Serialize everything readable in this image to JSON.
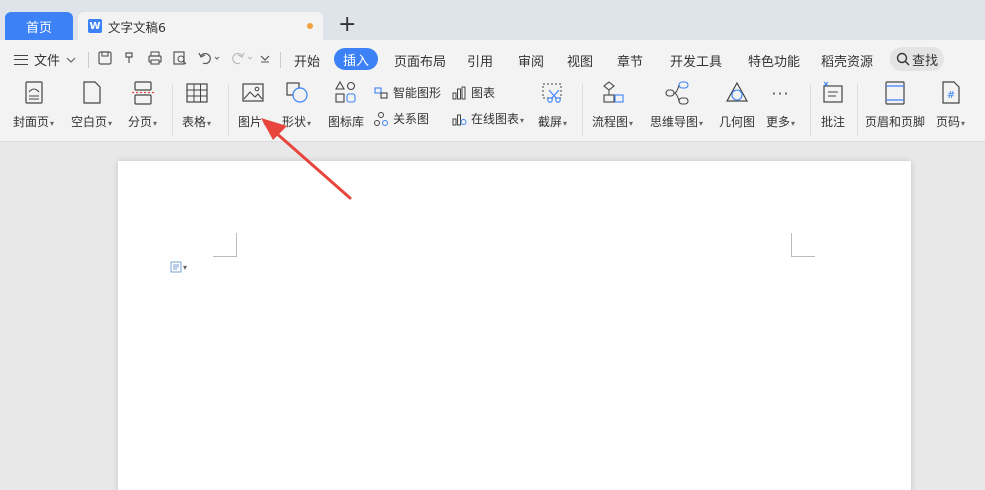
{
  "tabs": {
    "home": "首页",
    "doc_icon": "W",
    "document": "文字文稿6",
    "new_tab": "+"
  },
  "menu": {
    "file": "文件",
    "tabs": [
      "开始",
      "插入",
      "页面布局",
      "引用",
      "审阅",
      "视图",
      "章节",
      "开发工具",
      "特色功能",
      "稻壳资源"
    ],
    "active_tab": "插入",
    "search": "查找"
  },
  "ribbon": {
    "cover_page": "封面页",
    "blank_page": "空白页",
    "page_break": "分页",
    "table": "表格",
    "picture": "图片",
    "shape": "形状",
    "icon_library": "图标库",
    "smart_graphic": "智能图形",
    "chart": "图表",
    "relation_chart": "关系图",
    "online_chart": "在线图表",
    "screenshot": "截屏",
    "flowchart": "流程图",
    "mind_map": "思维导图",
    "geometry": "几何图",
    "more": "更多",
    "comment": "批注",
    "header_footer": "页眉和页脚",
    "page_number": "页码",
    "more_dots": "···",
    "page_number_symbol": "#"
  },
  "colors": {
    "accent": "#3c82f6",
    "arrow": "#e8453c",
    "unsaved_dot": "#f0a040"
  }
}
